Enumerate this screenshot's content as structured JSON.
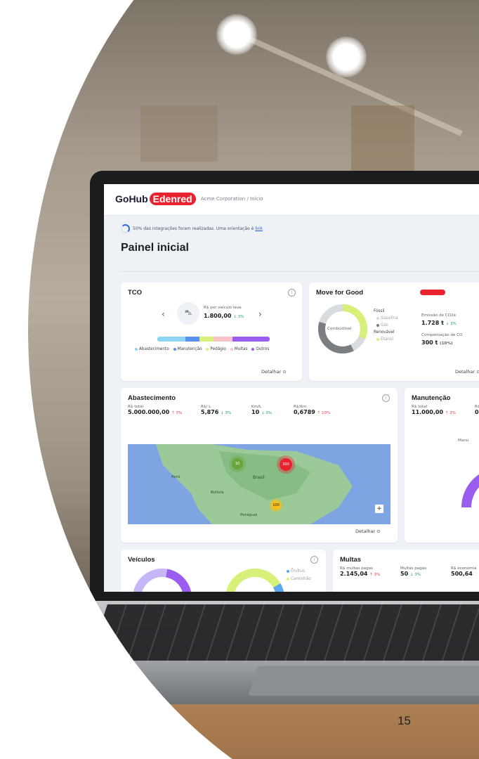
{
  "app": {
    "brand_left": "GoHub",
    "brand_right": "Edenred",
    "breadcrumb": "Acme Corporation / Início",
    "notice_text": "50% das integrações foram realizadas. Uma orientação é",
    "notice_link": "link",
    "page_title": "Painel inicial"
  },
  "tco": {
    "title": "TCO",
    "caption": "R$ por veículo leve",
    "value": "1.800,00",
    "delta": "↓ 3%",
    "legend": [
      "Abastecimento",
      "Manutenção",
      "Pedágio",
      "Multas",
      "Outros"
    ],
    "detail": "Detalhar"
  },
  "move": {
    "title": "Move for Good",
    "center_label": "Combustível",
    "legend": [
      "Fóssil",
      "Gasolina",
      "Gás",
      "Renovável",
      "Etanol"
    ],
    "emission_label": "Emissão de CO2e",
    "emission_value": "1.728 t",
    "emission_delta": "↓ 3%",
    "comp_label": "Compensação de CO",
    "comp_value": "300 t",
    "comp_pct": "(10%)",
    "detail": "Detalhar"
  },
  "abastecimento": {
    "title": "Abastecimento",
    "kpis": [
      {
        "label": "R$ total",
        "value": "5.000.000,00",
        "delta": "↑ 3%",
        "dir": "up"
      },
      {
        "label": "R$/ L",
        "value": "5,876",
        "delta": "↓ 3%",
        "dir": "down"
      },
      {
        "label": "Km/L",
        "value": "10",
        "delta": "↓ 3%",
        "dir": "down"
      },
      {
        "label": "R$/Km",
        "value": "0,6789",
        "delta": "↑ 10%",
        "dir": "up"
      }
    ],
    "map_labels": [
      "Brasil",
      "Perú",
      "Bolivia",
      "Paraguai"
    ],
    "markers": [
      "10",
      "300",
      "100"
    ],
    "zoom": "+",
    "detail": "Detalhar"
  },
  "manutencao": {
    "title": "Manutenção",
    "kpi_label": "R$ total",
    "kpi_value": "11.000,00",
    "kpi_delta": "↑ 3%",
    "kpi2_label": "R$",
    "kpi2_value": "0,",
    "chart_label": "Manu"
  },
  "veiculos": {
    "title": "Veículos",
    "legend": [
      "Ônibus",
      "Caminhão"
    ]
  },
  "multas": {
    "title": "Multas",
    "kpis": [
      {
        "label": "R$ multas pagas",
        "value": "2.145,04",
        "delta": "↑ 3%",
        "dir": "up"
      },
      {
        "label": "Multas pagas",
        "value": "50",
        "delta": "↓ 3%",
        "dir": "down"
      },
      {
        "label": "R$ economia",
        "value": "500,64",
        "delta": "",
        "dir": "down"
      }
    ]
  },
  "slide": {
    "page_number": "15"
  },
  "colors": {
    "accent": "#2c6be0",
    "brand_red": "#e8222e",
    "purple": "#9b5cf0",
    "lime": "#d6f07a",
    "sky": "#8fd3f5"
  }
}
